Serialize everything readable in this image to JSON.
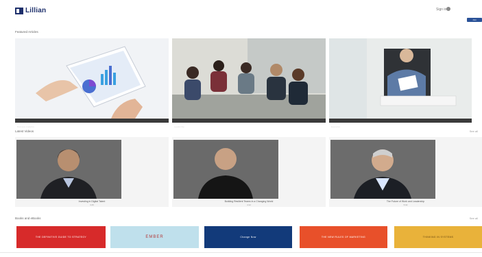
{
  "header": {
    "logo_text": "Lillian",
    "logo_sub": "",
    "signin": "Sign in",
    "button_label": "Join"
  },
  "sections": [
    {
      "title": "Featured Articles",
      "see_all": ""
    },
    {
      "title": "Latest Videos",
      "see_all": "See all"
    },
    {
      "title": "Books and eBooks",
      "see_all": "See all"
    }
  ],
  "featured": [
    {
      "caption": "Business Analytics"
    },
    {
      "caption": "Leadership"
    },
    {
      "caption": "Executive"
    }
  ],
  "videos": [
    {
      "title": "Investing in Digital Talent",
      "sub": "3:45"
    },
    {
      "title": "Building Resilient Teams in a Changing World",
      "sub": "4:12"
    },
    {
      "title": "The Future of Work and Leadership",
      "sub": "5:02"
    }
  ],
  "books": [
    {
      "label": "THE DEFINITIVE GUIDE TO STRATEGY",
      "color": "#d72a2a"
    },
    {
      "label": "EMBER",
      "color": "#bfe0ec"
    },
    {
      "label": "Change Now",
      "color": "#123a7a"
    },
    {
      "label": "THE NEW RULES OF MARKETING",
      "color": "#e8502a"
    },
    {
      "label": "THINKING IN SYSTEMS",
      "color": "#e9b23a"
    }
  ]
}
